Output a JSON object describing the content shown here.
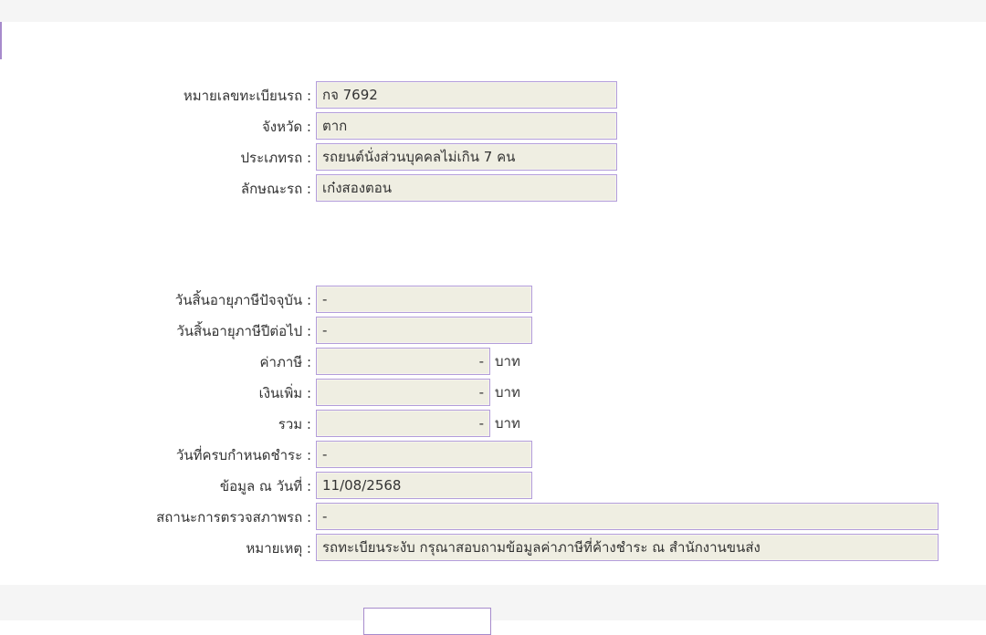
{
  "vehicle": {
    "plate_label": "หมายเลขทะเบียนรถ :",
    "plate_value": "กจ 7692",
    "province_label": "จังหวัด :",
    "province_value": "ตาก",
    "type_label": "ประเภทรถ :",
    "type_value": "รถยนต์นั่งส่วนบุคคลไม่เกิน 7 คน",
    "style_label": "ลักษณะรถ :",
    "style_value": "เก๋งสองตอน"
  },
  "tax": {
    "current_expiry_label": "วันสิ้นอายุภาษีปัจจุบัน :",
    "current_expiry_value": "-",
    "next_expiry_label": "วันสิ้นอายุภาษีปีต่อไป :",
    "next_expiry_value": "-",
    "tax_label": "ค่าภาษี :",
    "tax_value": "-",
    "surcharge_label": "เงินเพิ่ม :",
    "surcharge_value": "-",
    "total_label": "รวม :",
    "total_value": "-",
    "unit": "บาท",
    "due_date_label": "วันที่ครบกำหนดชำระ :",
    "due_date_value": "-",
    "data_date_label": "ข้อมูล ณ วันที่ :",
    "data_date_value": "11/08/2568",
    "inspection_label": "สถานะการตรวจสภาพรถ :",
    "inspection_value": "-",
    "remark_label": "หมายเหตุ :",
    "remark_value": "รถทะเบียนระงับ กรุณาสอบถามข้อมูลค่าภาษีที่ค้างชำระ ณ สำนักงานขนส่ง"
  },
  "colors": {
    "field_bg": "#efeee2",
    "field_border": "#b39ddb",
    "accent": "#a78bcc"
  }
}
